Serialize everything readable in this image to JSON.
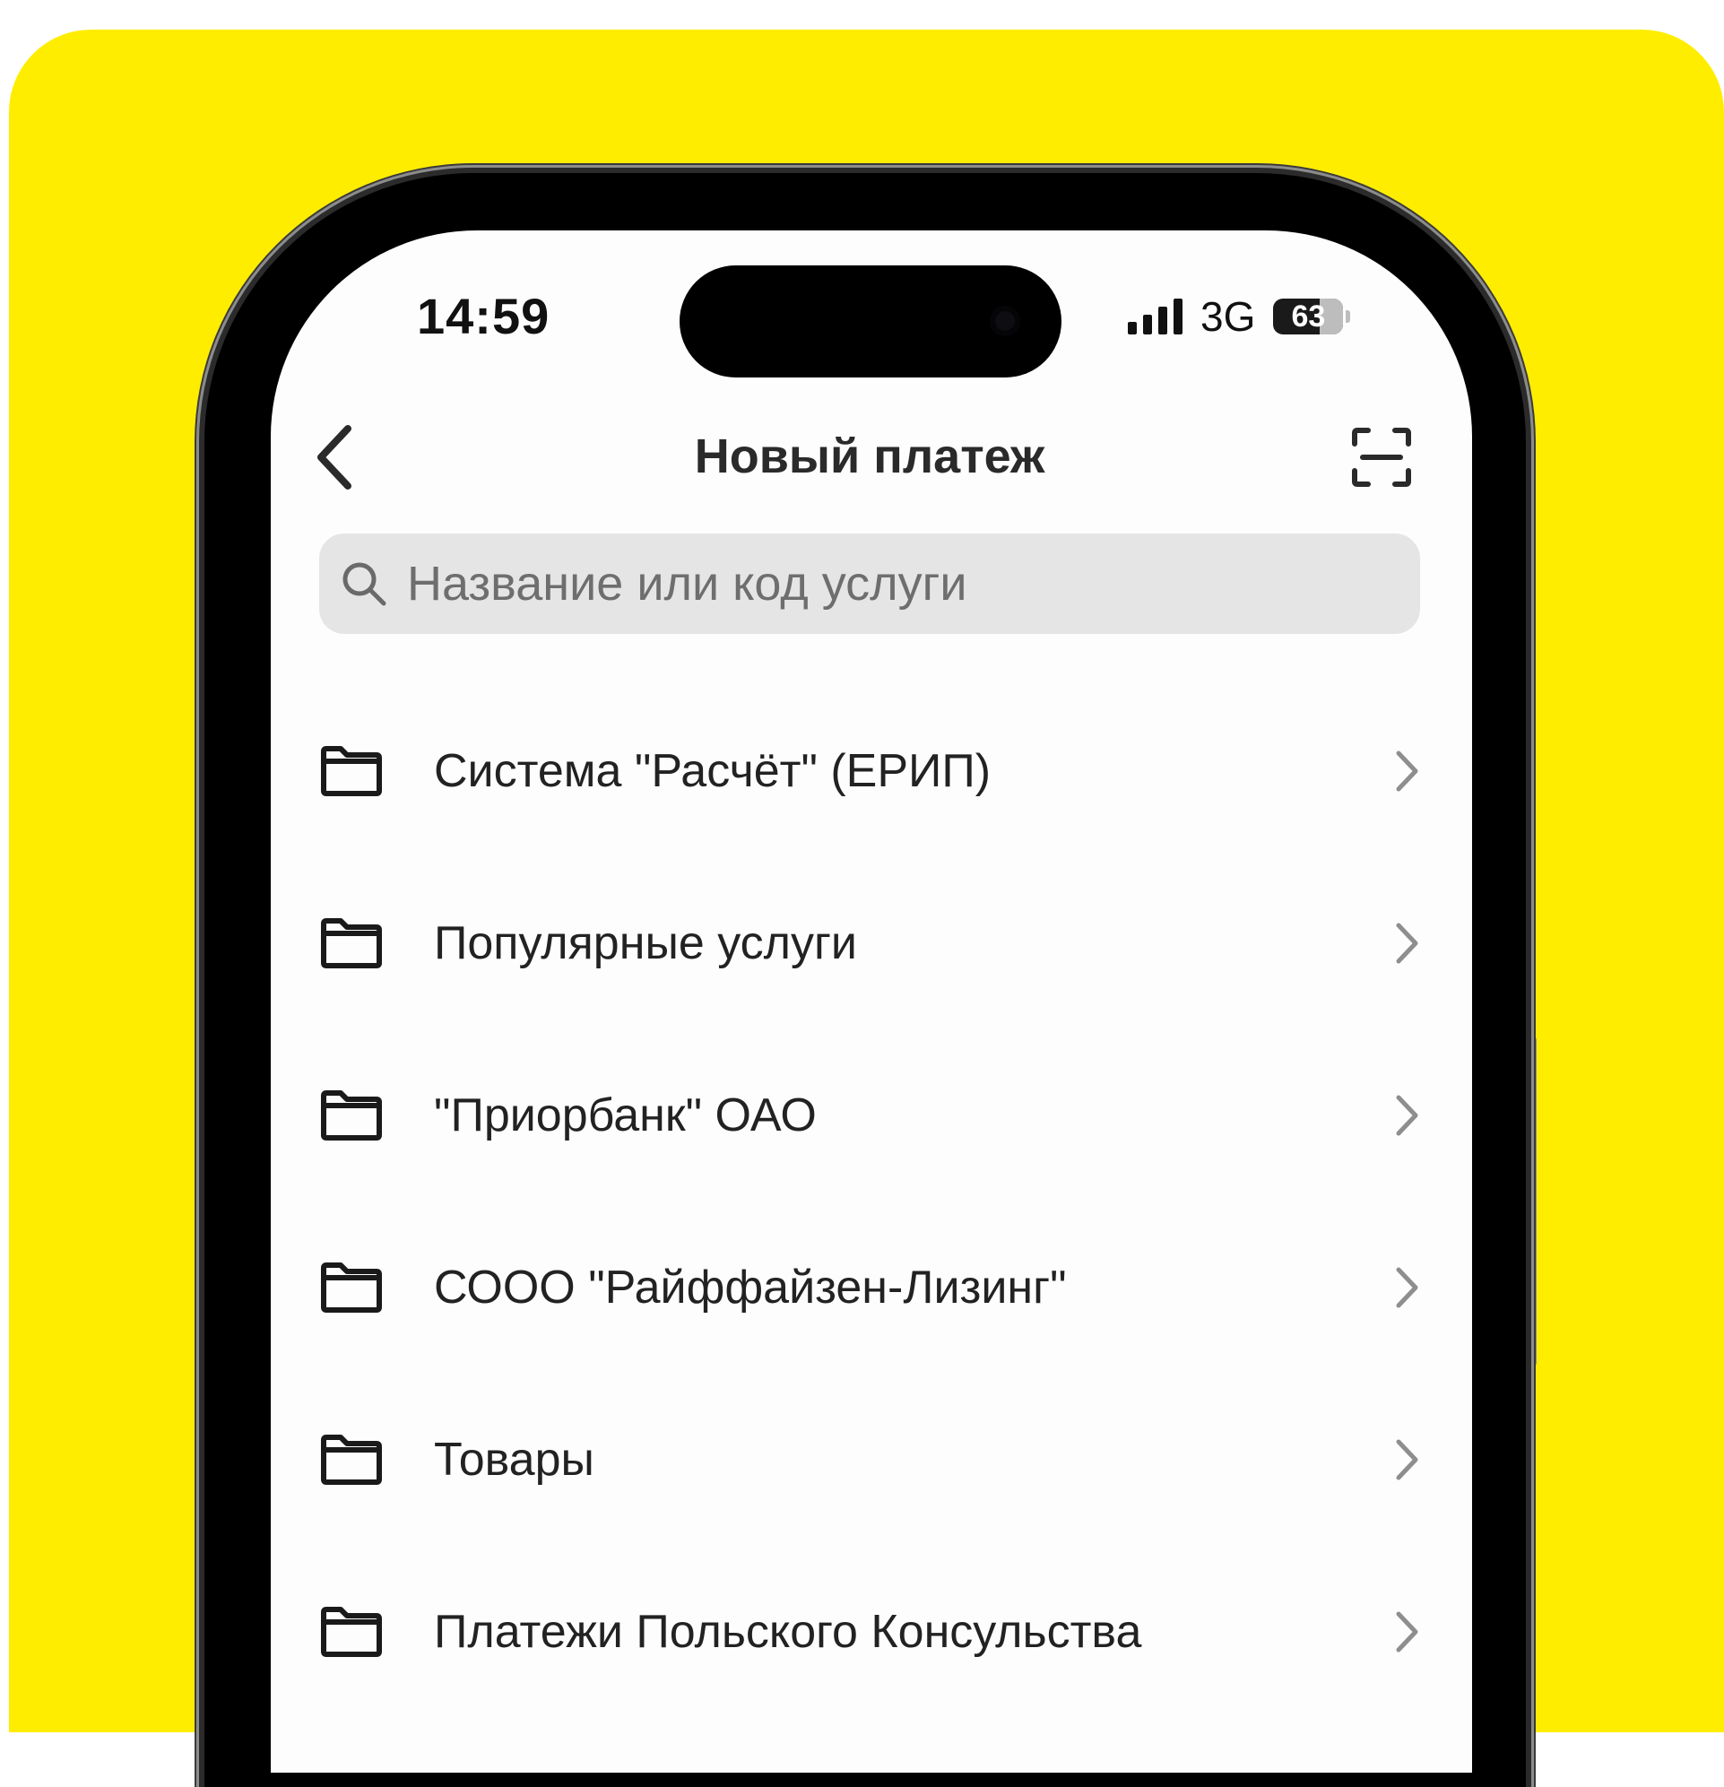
{
  "status_bar": {
    "time": "14:59",
    "network": "3G",
    "battery": "63",
    "signal_bars": 4
  },
  "header": {
    "title": "Новый платеж",
    "back_icon": "chevron-left-icon",
    "scan_icon": "scan-icon"
  },
  "search": {
    "placeholder": "Название или код услуги",
    "value": "",
    "icon": "search-icon"
  },
  "categories": [
    {
      "label": "Система \"Расчёт\" (ЕРИП)",
      "icon": "folder-icon"
    },
    {
      "label": "Популярные услуги",
      "icon": "folder-icon"
    },
    {
      "label": "\"Приорбанк\" ОАО",
      "icon": "folder-icon"
    },
    {
      "label": "СООО \"Райффайзен-Лизинг\"",
      "icon": "folder-icon"
    },
    {
      "label": "Товары",
      "icon": "folder-icon"
    },
    {
      "label": "Платежи Польского Консульства",
      "icon": "folder-icon"
    }
  ],
  "colors": {
    "background": "#FFED00",
    "screen": "#FDFDFD",
    "text": "#222222",
    "search_bg": "#E5E5E5"
  }
}
